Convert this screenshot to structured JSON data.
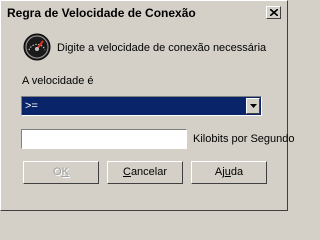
{
  "window": {
    "title": "Regra de Velocidade de Conexão",
    "close_glyph": "×"
  },
  "icon": {
    "name": "speedometer-icon"
  },
  "prompt": "Digite a velocidade de conexão necessária",
  "speed_label": "A velocidade é",
  "operator_select": {
    "value": ">="
  },
  "speed_input": {
    "value": "",
    "unit_label": "Kilobits por Segundo"
  },
  "buttons": {
    "ok": {
      "pre": "O",
      "mnemonic": "K",
      "post": "",
      "enabled": false
    },
    "cancel": {
      "pre": "",
      "mnemonic": "C",
      "post": "ancelar",
      "enabled": true
    },
    "help": {
      "pre": "Aj",
      "mnemonic": "u",
      "post": "da",
      "enabled": true
    }
  },
  "colors": {
    "face": "#d4d0c8",
    "selection": "#0a246a",
    "disabled_text": "#a0a0a0"
  }
}
